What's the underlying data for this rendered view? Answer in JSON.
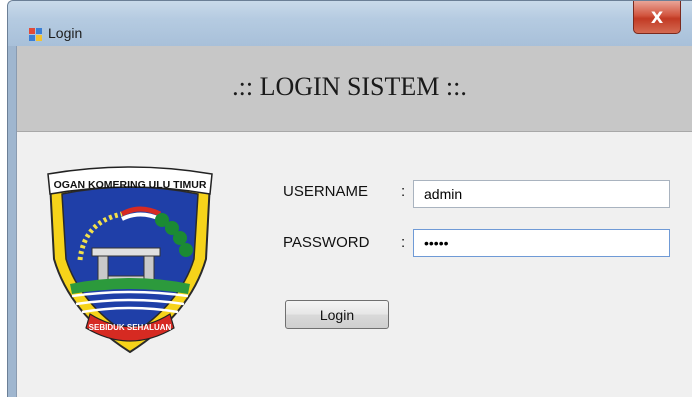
{
  "window": {
    "title": "Login",
    "close_glyph": "X"
  },
  "header": {
    "title": ".:: LOGIN SISTEM ::."
  },
  "logo": {
    "top_text": "OGAN KOMERING ULU TIMUR",
    "ribbon_text": "SEBIDUK SEHALUAN"
  },
  "form": {
    "username_label": "USERNAME",
    "password_label": "PASSWORD",
    "colon": ":",
    "username_value": "admin",
    "password_value": "admin",
    "login_label": "Login"
  },
  "icons": {
    "app": "window-app-icon",
    "close": "close-icon"
  },
  "colors": {
    "accent": "#6f9ad6",
    "close": "#c23a24",
    "header_band": "#c7c7c7"
  }
}
